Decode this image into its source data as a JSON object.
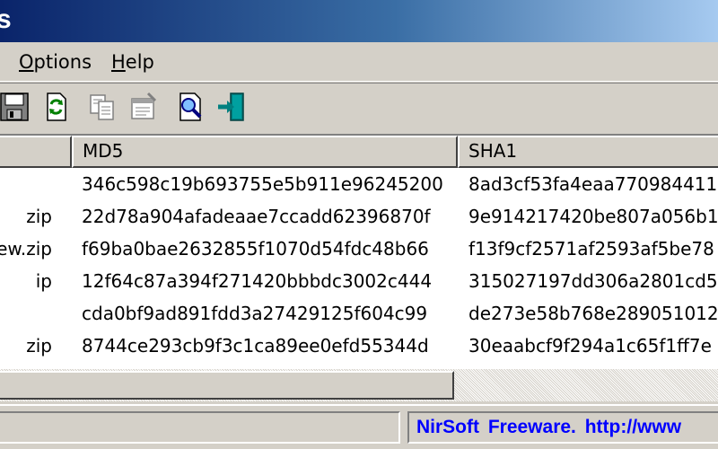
{
  "window": {
    "title": "s"
  },
  "menu": [
    {
      "label": "Options",
      "mnemonic": "O",
      "rest": "ptions"
    },
    {
      "label": "Help",
      "mnemonic": "H",
      "rest": "elp"
    }
  ],
  "toolbar": {
    "buttons": [
      "save-icon",
      "refresh-icon",
      "copy-icon",
      "properties-icon",
      "find-icon",
      "exit-icon"
    ]
  },
  "table": {
    "columns": [
      "",
      "MD5",
      "SHA1"
    ],
    "rows": [
      {
        "filename": "",
        "md5": "346c598c19b693755e5b911e96245200",
        "sha1": "8ad3cf53fa4eaa770984411"
      },
      {
        "filename": "zip",
        "md5": "22d78a904afadeaae7ccadd62396870f",
        "sha1": "9e914217420be807a056b1"
      },
      {
        "filename": "ew.zip",
        "md5": "f69ba0bae2632855f1070d54fdc48b66",
        "sha1": "f13f9cf2571af2593af5be78"
      },
      {
        "filename": "ip",
        "md5": "12f64c87a394f271420bbbdc3002c444",
        "sha1": "315027197dd306a2801cd5e"
      },
      {
        "filename": "",
        "md5": "cda0bf9ad891fdd3a27429125f604c99",
        "sha1": "de273e58b768e289051012"
      },
      {
        "filename": "zip",
        "md5": "8744ce293cb9f3c1ca89ee0efd55344d",
        "sha1": "30eaabcf9f294a1c65f1ff7e"
      }
    ]
  },
  "status": {
    "left_text": "",
    "link_text": "NirSoft Freeware.  http://www"
  },
  "colors": {
    "link": "#0000ff",
    "titlebar_start": "#0a246a",
    "titlebar_end": "#a6caf0",
    "face": "#d4d0c8"
  }
}
